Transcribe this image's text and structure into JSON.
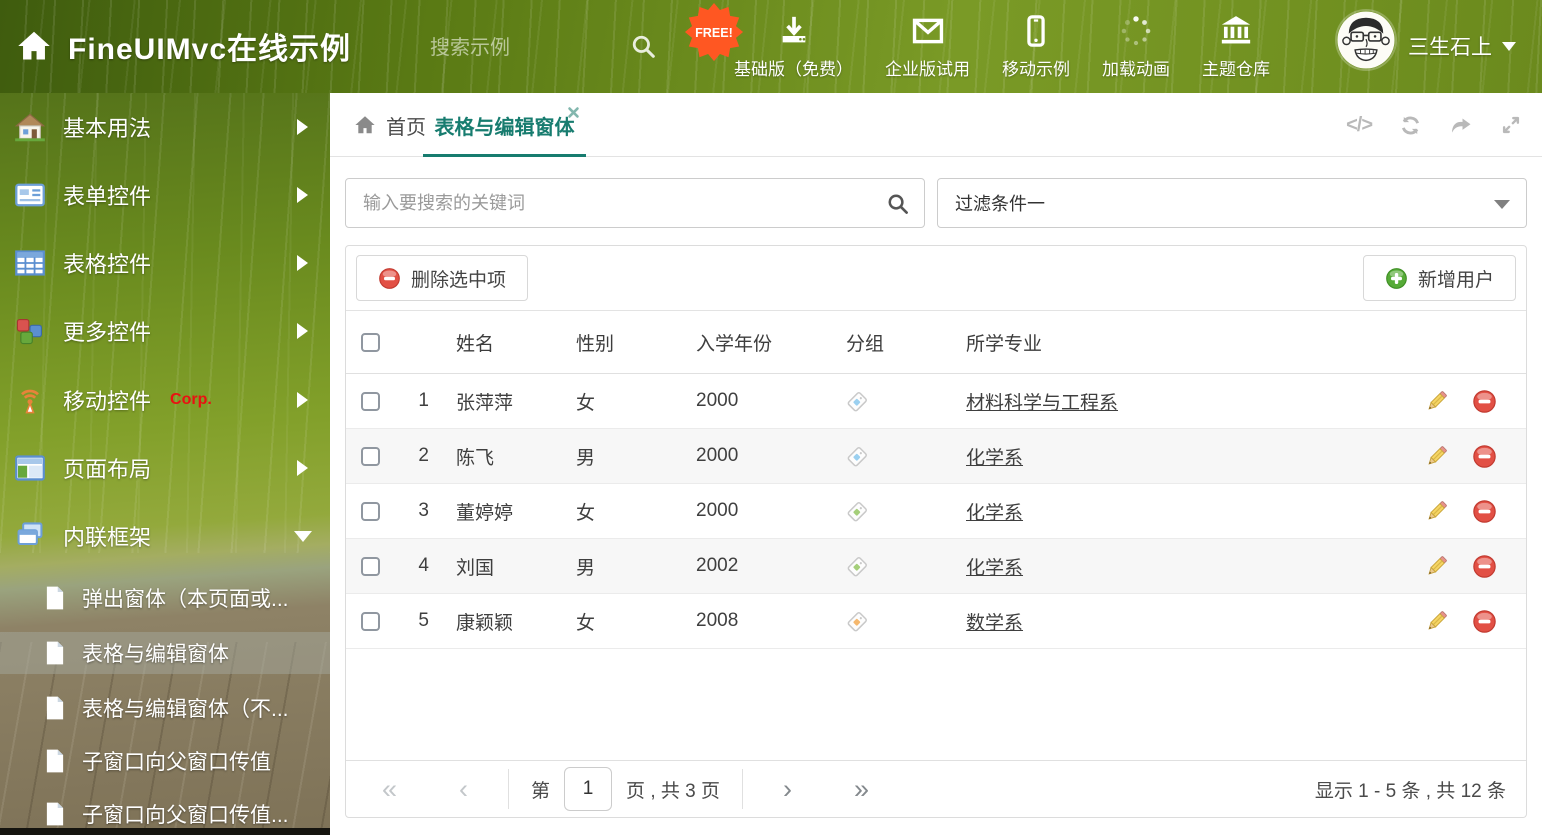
{
  "header": {
    "title": "FineUIMvc在线示例",
    "search_placeholder": "搜索示例",
    "free_badge": "FREE!",
    "nav": [
      {
        "label": "基础版（免费）"
      },
      {
        "label": "企业版试用"
      },
      {
        "label": "移动示例"
      },
      {
        "label": "加载动画"
      },
      {
        "label": "主题仓库"
      }
    ],
    "user_name": "三生石上"
  },
  "sidebar": {
    "items": [
      {
        "label": "基本用法"
      },
      {
        "label": "表单控件"
      },
      {
        "label": "表格控件"
      },
      {
        "label": "更多控件"
      },
      {
        "label": "移动控件",
        "badge": "Corp."
      },
      {
        "label": "页面布局"
      },
      {
        "label": "内联框架"
      }
    ],
    "subitems": [
      {
        "label": "弹出窗体（本页面或..."
      },
      {
        "label": "表格与编辑窗体"
      },
      {
        "label": "表格与编辑窗体（不..."
      },
      {
        "label": "子窗口向父窗口传值"
      },
      {
        "label": "子窗口向父窗口传值..."
      }
    ]
  },
  "tabs": {
    "home_label": "首页",
    "active_label": "表格与编辑窗体"
  },
  "search": {
    "keyword_placeholder": "输入要搜索的关键词",
    "filter_value": "过滤条件一"
  },
  "toolbar": {
    "delete_label": "删除选中项",
    "add_label": "新增用户"
  },
  "table": {
    "columns": {
      "name": "姓名",
      "gender": "性别",
      "year": "入学年份",
      "group": "分组",
      "major": "所学专业"
    },
    "rows": [
      {
        "num": "1",
        "name": "张萍萍",
        "gender": "女",
        "year": "2000",
        "tag": "blue",
        "major": "材料科学与工程系"
      },
      {
        "num": "2",
        "name": "陈飞",
        "gender": "男",
        "year": "2000",
        "tag": "blue",
        "major": "化学系"
      },
      {
        "num": "3",
        "name": "董婷婷",
        "gender": "女",
        "year": "2000",
        "tag": "green",
        "major": "化学系"
      },
      {
        "num": "4",
        "name": "刘国",
        "gender": "男",
        "year": "2002",
        "tag": "green",
        "major": "化学系"
      },
      {
        "num": "5",
        "name": "康颖颖",
        "gender": "女",
        "year": "2008",
        "tag": "orange",
        "major": "数学系"
      }
    ]
  },
  "pagination": {
    "first": "«",
    "prev": "‹",
    "next": "›",
    "last": "»",
    "page_prefix": "第",
    "page_value": "1",
    "page_suffix": "页 , 共 3 页",
    "summary": "显示 1 - 5 条 , 共 12 条"
  },
  "colors": {
    "accent_teal": "#177c6f",
    "delete_red": "#e2574c",
    "add_green": "#55a532",
    "tag_blue": "#9bd0f0",
    "tag_green": "#a5cf7a",
    "tag_orange": "#f5b86e",
    "free_badge_orange": "#ff5722"
  }
}
